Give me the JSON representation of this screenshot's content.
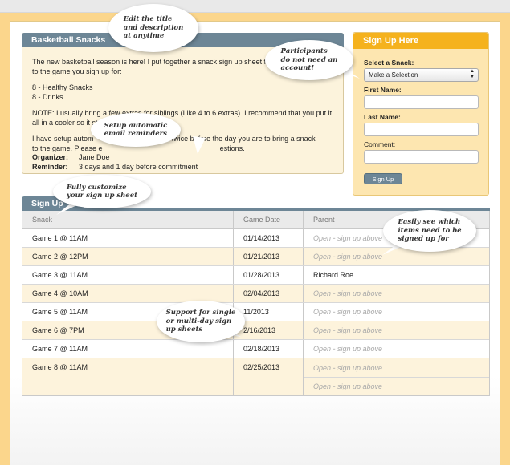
{
  "description_panel": {
    "title": "Basketball Snacks",
    "paragraph1": "The new basketball season is here! I put together a snack sign up sheet for bring the following to the game you sign up for:",
    "list_line1": "8 - Healthy Snacks",
    "list_line2": "8 - Drinks",
    "note": "NOTE: I usually bring a few extras for siblings (Like 4 to 6 extras). I recommend that you put it all in a cooler so it stays",
    "setup_line1": "I have setup autom",
    "setup_line1_end": "t twice before the day you are to bring a snack",
    "setup_line2": "to the game. Please e",
    "setup_line2_end": "estions.",
    "organizer_label": "Organizer:",
    "organizer_value": "Jane Doe",
    "reminder_label": "Reminder:",
    "reminder_value": "3 days and 1 day before commitment"
  },
  "signup_form": {
    "title": "Sign Up Here",
    "snack_label": "Select a Snack:",
    "snack_selected": "Make a Selection",
    "first_name_label": "First Name:",
    "last_name_label": "Last Name:",
    "comment_label": "Comment:",
    "button_label": "Sign Up"
  },
  "signups": {
    "title": "Sign Up",
    "columns": [
      "Snack",
      "Game Date",
      "Parent"
    ],
    "rows": [
      {
        "snack": "Game 1 @ 11AM",
        "date": "01/14/2013",
        "parent": "Open - sign up above",
        "open": true
      },
      {
        "snack": "Game 2 @ 12PM",
        "date": "01/21/2013",
        "parent": "Open - sign up above",
        "open": true
      },
      {
        "snack": "Game 3 @ 11AM",
        "date": "01/28/2013",
        "parent": "Richard Roe",
        "open": false
      },
      {
        "snack": "Game 4 @ 10AM",
        "date": "02/04/2013",
        "parent": "Open - sign up above",
        "open": true
      },
      {
        "snack": "Game 5 @ 11AM",
        "date": "11/2013",
        "parent": "Open - sign up above",
        "open": true
      },
      {
        "snack": "Game 6 @ 7PM",
        "date": "2/16/2013",
        "parent": "Open - sign up above",
        "open": true
      },
      {
        "snack": "Game 7 @ 11AM",
        "date": "02/18/2013",
        "parent": "Open - sign up above",
        "open": true
      }
    ],
    "last_row": {
      "snack": "Game 8 @ 11AM",
      "date": "02/25/2013",
      "parent1": "Open - sign up above",
      "parent2": "Open - sign up above"
    }
  },
  "callouts": {
    "edit_title": "Edit the title\nand description\nat anytime",
    "participants": "Participants\ndo not need an\naccount!",
    "email_reminders": "Setup automatic\nemail reminders",
    "customize": "Fully customize\nyour sign up sheet",
    "easily_see": "Easily see which\nitems need to be\nsigned up for",
    "multi_day": "Support for single\nor multi-day sign\nup sheets"
  }
}
